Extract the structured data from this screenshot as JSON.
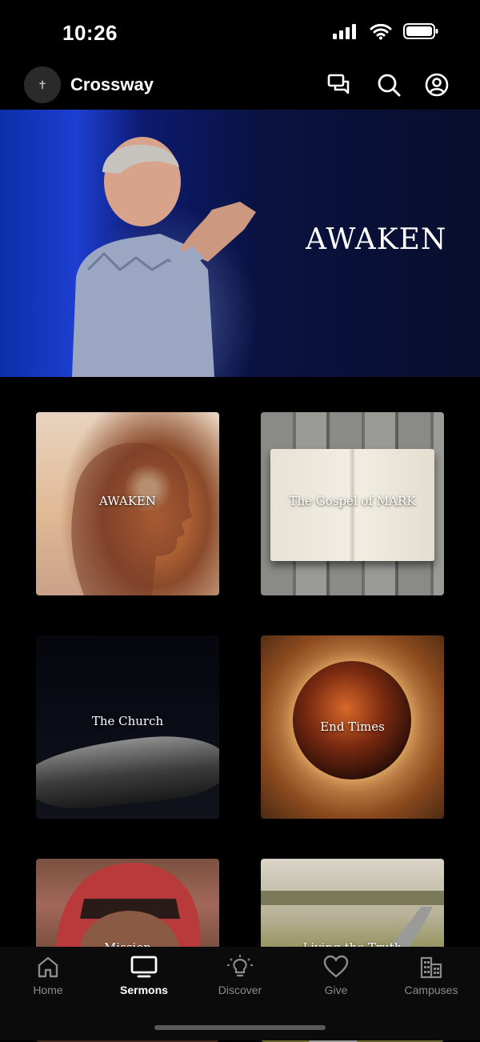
{
  "status_bar": {
    "time": "10:26"
  },
  "header": {
    "title": "Crossway",
    "avatar_glyph": "✝"
  },
  "hero": {
    "title": "AWAKEN"
  },
  "series": [
    {
      "label": "AWAKEN"
    },
    {
      "label": "The Gospel of MARK"
    },
    {
      "label": "The Church"
    },
    {
      "label": "End Times"
    },
    {
      "label": "Mission"
    },
    {
      "label": "Living the Truth"
    }
  ],
  "tabs": [
    {
      "label": "Home",
      "icon": "home-icon"
    },
    {
      "label": "Sermons",
      "icon": "tv-icon",
      "active": true
    },
    {
      "label": "Discover",
      "icon": "lightbulb-icon"
    },
    {
      "label": "Give",
      "icon": "heart-icon"
    },
    {
      "label": "Campuses",
      "icon": "building-icon"
    }
  ]
}
